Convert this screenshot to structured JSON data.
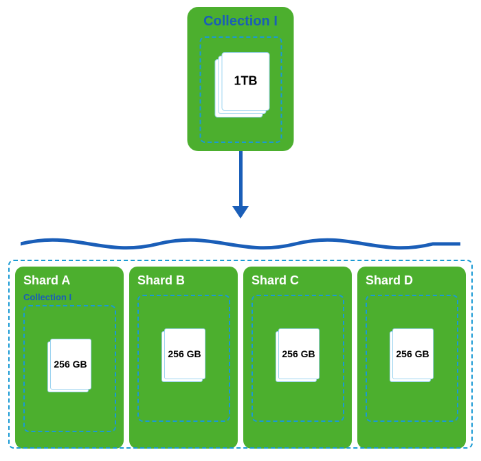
{
  "collection_top": {
    "label": "Collection I",
    "size": "1TB"
  },
  "shards": [
    {
      "label": "Shard A",
      "size": "256 GB"
    },
    {
      "label": "Shard B",
      "size": "256 GB"
    },
    {
      "label": "Shard C",
      "size": "256 GB"
    },
    {
      "label": "Shard D",
      "size": "256 GB"
    }
  ],
  "collection_sub_label": "Collection I",
  "colors": {
    "green": "#4caf2e",
    "blue_label": "#1a5eb8",
    "blue_dashed": "#1a9ad4"
  }
}
